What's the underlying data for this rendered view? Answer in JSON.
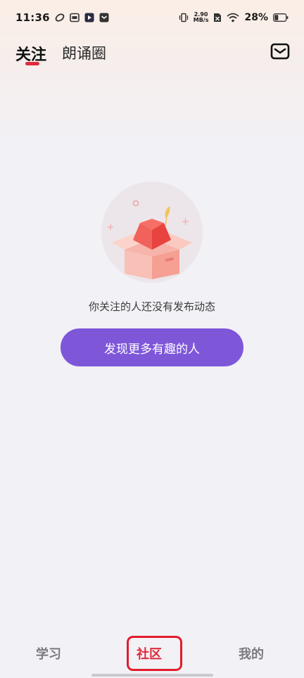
{
  "status_bar": {
    "time": "11:36",
    "net_speed_value": "2.90",
    "net_speed_unit": "MB/s",
    "battery_percent": "28%"
  },
  "header": {
    "tabs": [
      {
        "label": "关注",
        "active": true
      },
      {
        "label": "朗诵圈",
        "active": false
      }
    ]
  },
  "empty_state": {
    "message": "你关注的人还没有发布动态",
    "button_label": "发现更多有趣的人"
  },
  "bottom_nav": {
    "items": [
      {
        "label": "学习",
        "active": false
      },
      {
        "label": "社区",
        "active": true
      },
      {
        "label": "我的",
        "active": false
      }
    ]
  },
  "colors": {
    "accent_red": "#e02a3a",
    "button_purple": "#7e57d9",
    "highlight_box": "#e21b2c"
  }
}
